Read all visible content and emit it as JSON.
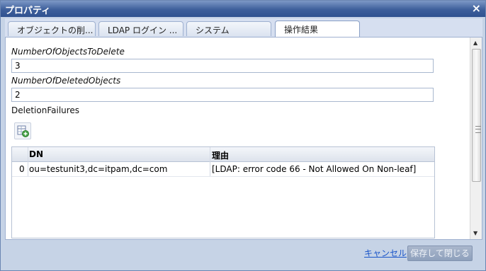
{
  "dialog": {
    "title": "プロパティ",
    "close_symbol": "×"
  },
  "tabs": [
    {
      "label": "オブジェクトの削..."
    },
    {
      "label": "LDAP ログイン ..."
    },
    {
      "label": "システム"
    },
    {
      "label": "操作結果"
    }
  ],
  "fields": {
    "objects_to_delete": {
      "label": "NumberOfObjectsToDelete",
      "value": "3"
    },
    "deleted_objects": {
      "label": "NumberOfDeletedObjects",
      "value": "2"
    },
    "failures_label": "DeletionFailures"
  },
  "grid": {
    "columns": [
      "DN",
      "理由"
    ],
    "rows": [
      {
        "index": "0",
        "dn": "ou=testunit3,dc=itpam,dc=com",
        "reason": "[LDAP: error code 66 - Not Allowed On Non-leaf]"
      }
    ]
  },
  "footer": {
    "cancel_label": "キャンセル",
    "save_close_label": "保存して閉じる"
  },
  "icons": [
    "close-icon",
    "add-row-icon",
    "scroll-up-icon",
    "scroll-down-icon"
  ]
}
